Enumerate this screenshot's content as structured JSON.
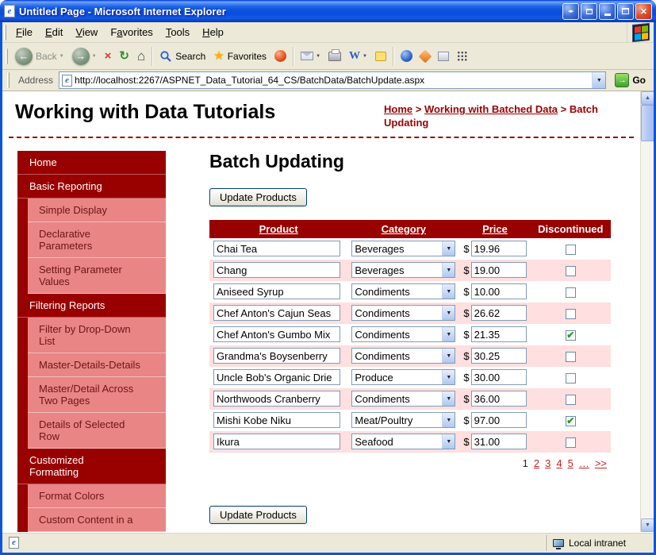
{
  "window": {
    "title": "Untitled Page - Microsoft Internet Explorer",
    "status_zone": "Local intranet"
  },
  "menubar": {
    "items": [
      {
        "label": "File",
        "underline": 0
      },
      {
        "label": "Edit",
        "underline": 0
      },
      {
        "label": "View",
        "underline": 0
      },
      {
        "label": "Favorites",
        "underline": 1
      },
      {
        "label": "Tools",
        "underline": 0
      },
      {
        "label": "Help",
        "underline": 0
      }
    ]
  },
  "toolbar": {
    "back_label": "Back",
    "search_label": "Search",
    "favorites_label": "Favorites"
  },
  "addressbar": {
    "label": "Address",
    "url": "http://localhost:2267/ASPNET_Data_Tutorial_64_CS/BatchData/BatchUpdate.aspx",
    "go_label": "Go"
  },
  "page": {
    "header_title": "Working with Data Tutorials",
    "breadcrumb_separator": ">",
    "breadcrumb": [
      {
        "label": "Home",
        "link": true
      },
      {
        "label": "Working with Batched Data",
        "link": true
      },
      {
        "label": "Batch Updating",
        "link": false
      }
    ]
  },
  "sidebar": {
    "items": [
      {
        "label": "Home",
        "type": "section"
      },
      {
        "label": "Basic Reporting",
        "type": "section"
      },
      {
        "label": "Simple Display",
        "type": "sub"
      },
      {
        "label": "Declarative Parameters",
        "type": "sub"
      },
      {
        "label": "Setting Parameter Values",
        "type": "sub"
      },
      {
        "label": "Filtering Reports",
        "type": "section"
      },
      {
        "label": "Filter by Drop-Down List",
        "type": "sub"
      },
      {
        "label": "Master-Details-Details",
        "type": "sub"
      },
      {
        "label": "Master/Detail Across Two Pages",
        "type": "sub"
      },
      {
        "label": "Details of Selected Row",
        "type": "sub"
      },
      {
        "label": "Customized Formatting",
        "type": "section"
      },
      {
        "label": "Format Colors",
        "type": "sub"
      },
      {
        "label": "Custom Content in a",
        "type": "sub"
      }
    ]
  },
  "main": {
    "title": "Batch Updating",
    "update_button_label": "Update Products",
    "table": {
      "headers": [
        {
          "label": "Product",
          "link": true
        },
        {
          "label": "Category",
          "link": true
        },
        {
          "label": "Price",
          "link": true
        },
        {
          "label": "Discontinued",
          "link": false
        }
      ],
      "currency_symbol": "$",
      "rows": [
        {
          "product": "Chai Tea",
          "category": "Beverages",
          "price": "19.96",
          "discontinued": false
        },
        {
          "product": "Chang",
          "category": "Beverages",
          "price": "19.00",
          "discontinued": false
        },
        {
          "product": "Aniseed Syrup",
          "category": "Condiments",
          "price": "10.00",
          "discontinued": false
        },
        {
          "product": "Chef Anton's Cajun Seas",
          "category": "Condiments",
          "price": "26.62",
          "discontinued": false
        },
        {
          "product": "Chef Anton's Gumbo Mix",
          "category": "Condiments",
          "price": "21.35",
          "discontinued": true
        },
        {
          "product": "Grandma's Boysenberry",
          "category": "Condiments",
          "price": "30.25",
          "discontinued": false
        },
        {
          "product": "Uncle Bob's Organic Drie",
          "category": "Produce",
          "price": "30.00",
          "discontinued": false
        },
        {
          "product": "Northwoods Cranberry",
          "category": "Condiments",
          "price": "36.00",
          "discontinued": false
        },
        {
          "product": "Mishi Kobe Niku",
          "category": "Meat/Poultry",
          "price": "97.00",
          "discontinued": true
        },
        {
          "product": "Ikura",
          "category": "Seafood",
          "price": "31.00",
          "discontinued": false
        }
      ],
      "pager": {
        "pages": [
          {
            "label": "1",
            "current": true
          },
          {
            "label": "2"
          },
          {
            "label": "3"
          },
          {
            "label": "4"
          },
          {
            "label": "5"
          },
          {
            "label": "…"
          },
          {
            "label": ">>"
          }
        ]
      }
    }
  },
  "icons": {
    "ie_e": "e",
    "close": "×",
    "left_right": "◂▸",
    "back_arrow": "←",
    "forward_arrow": "→",
    "stop": "×",
    "refresh": "↻",
    "home": "⌂",
    "star": "★",
    "edit_w": "W",
    "chevron_down": "▼",
    "up_arrow": "▲",
    "down_arrow": "▼",
    "go_arrow": "→",
    "check": "✔"
  },
  "colors": {
    "accent": "#990000",
    "nav_sub_bg": "#E98585",
    "nav_sub_text": "#6E1515",
    "alt_row_bg": "#FFDFDF",
    "pager_link": "#CC2222",
    "check_green": "#1E9E1E"
  }
}
